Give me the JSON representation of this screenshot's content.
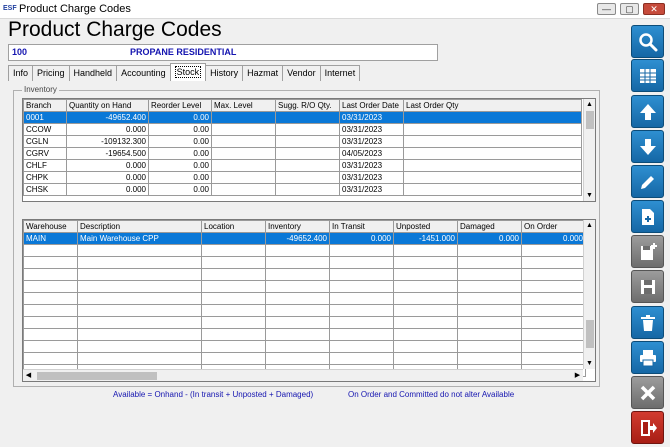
{
  "window": {
    "icon_text": "ESF",
    "title": "Product Charge Codes",
    "minimize": "—",
    "maximize": "▢",
    "close": "✕"
  },
  "header": {
    "title": "Product Charge Codes",
    "code": "100",
    "name": "PROPANE RESIDENTIAL"
  },
  "tabs": [
    "Info",
    "Pricing",
    "Handheld",
    "Accounting",
    "Stock",
    "History",
    "Hazmat",
    "Vendor",
    "Internet"
  ],
  "active_tab": "Stock",
  "inventory": {
    "label": "Inventory",
    "columns": [
      "Branch",
      "Quantity on Hand",
      "Reorder Level",
      "Max. Level",
      "Sugg. R/O Qty.",
      "Last Order Date",
      "Last Order Qty"
    ],
    "rows": [
      [
        "0001",
        "-49652.400",
        "0.00",
        "",
        "",
        "03/31/2023",
        ""
      ],
      [
        "CCOW",
        "0.000",
        "0.00",
        "",
        "",
        "03/31/2023",
        ""
      ],
      [
        "CGLN",
        "-109132.300",
        "0.00",
        "",
        "",
        "03/31/2023",
        ""
      ],
      [
        "CGRV",
        "-19654.500",
        "0.00",
        "",
        "",
        "04/05/2023",
        ""
      ],
      [
        "CHLF",
        "0.000",
        "0.00",
        "",
        "",
        "03/31/2023",
        ""
      ],
      [
        "CHPK",
        "0.000",
        "0.00",
        "",
        "",
        "03/31/2023",
        ""
      ],
      [
        "CHSK",
        "0.000",
        "0.00",
        "",
        "",
        "03/31/2023",
        ""
      ]
    ]
  },
  "warehouse": {
    "columns": [
      "Warehouse",
      "Description",
      "Location",
      "Inventory",
      "In Transit",
      "Unposted",
      "Damaged",
      "On Order"
    ],
    "rows": [
      [
        "MAIN",
        "Main Warehouse CPP",
        "",
        "-49652.400",
        "0.000",
        "-1451.000",
        "0.000",
        "0.000"
      ]
    ]
  },
  "notes": {
    "available": "Available = Onhand - (In transit + Unposted + Damaged)",
    "on_order": "On Order and Committed do not alter Available"
  },
  "sidebar_buttons": [
    "search-icon",
    "grid-icon",
    "arrow-up-icon",
    "arrow-down-icon",
    "edit-icon",
    "new-document-icon",
    "copy-icon",
    "save-icon",
    "delete-icon",
    "print-icon",
    "cancel-icon",
    "exit-icon"
  ],
  "colors": {
    "selection": "#0a78d7",
    "label_blue": "#1515b0",
    "button_blue": "#1e78bd",
    "button_grey": "#7d7d7d",
    "button_red": "#bf2a20"
  }
}
